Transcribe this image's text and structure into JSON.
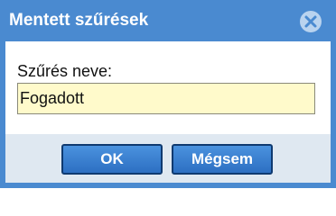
{
  "dialog": {
    "title": "Mentett szűrések",
    "close_icon": "close-icon",
    "field": {
      "label": "Szűrés neve:",
      "value": "Fogadott"
    },
    "buttons": {
      "ok_label": "OK",
      "cancel_label": "Mégsem"
    }
  },
  "colors": {
    "titlebar": "#4a8ad0",
    "input_background": "#fffacb",
    "footer_background": "#dfe8f1",
    "button": "#3a80d0",
    "button_border": "#0f3a70"
  }
}
